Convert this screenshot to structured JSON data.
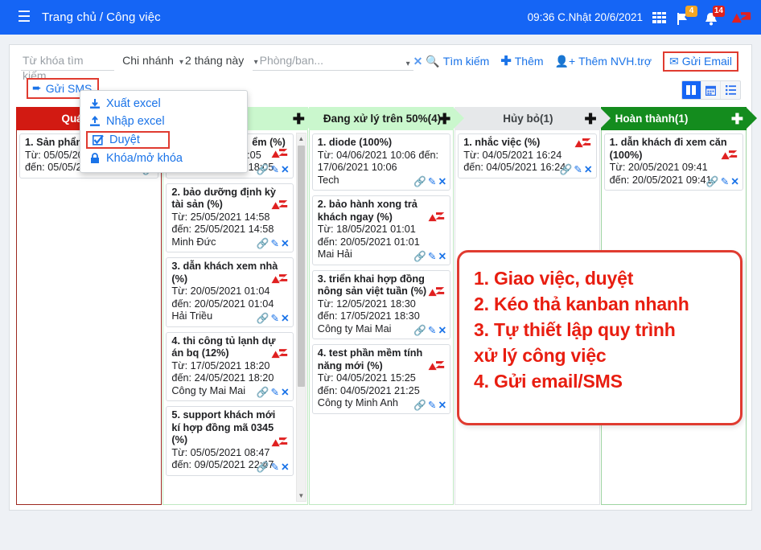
{
  "topbar": {
    "menu_icon": "hamburger-icon",
    "breadcrumb_home": "Trang chủ",
    "breadcrumb_sep": "/",
    "breadcrumb_current": "Công việc",
    "clock": "09:36  C.Nhật 20/6/2021",
    "apps_icon": "grid-apps-icon",
    "flag_badge": "4",
    "bell_badge": "14",
    "logo": "az-logo"
  },
  "filters": {
    "keyword_placeholder": "Từ khóa tìm kiếm...",
    "branch": "Chi nhánh",
    "period": "2 tháng này",
    "dept_placeholder": "Phòng/ban...",
    "search": "Tìm kiếm",
    "add": "Thêm",
    "add_support": "Thêm NVH.trợ",
    "send_email": "Gửi Email",
    "send_sms": "Gửi SMS"
  },
  "viewtoggle": {
    "kanban": "kanban-view-icon",
    "calendar": "calendar-view-icon",
    "list": "list-view-icon"
  },
  "menu": {
    "items": [
      {
        "label": "Xuất excel",
        "icon": "download-excel-icon",
        "highlighted": false
      },
      {
        "label": "Nhập excel",
        "icon": "upload-excel-icon",
        "highlighted": false
      },
      {
        "label": "Duyệt",
        "icon": "approve-check-icon",
        "highlighted": true
      },
      {
        "label": "Khóa/mở khóa",
        "icon": "lock-icon",
        "highlighted": false
      }
    ]
  },
  "board": {
    "columns": [
      {
        "title": "Quá hạn(1)",
        "cards": [
          {
            "title": "1. Sản phẩm l",
            "line1": "Từ: 05/05/202",
            "line2": "đến: 05/05/2021 00:09",
            "who": ""
          }
        ]
      },
      {
        "title": "",
        "cards": [
          {
            "title": "ểm (%)",
            "line1": "3:05",
            "line2": "đến: 31/05/2021 18:05",
            "who": ""
          },
          {
            "title": "2. bảo dưỡng định kỳ tài sản (%)",
            "line1": "Từ: 25/05/2021 14:58",
            "line2": "đến: 25/05/2021 14:58",
            "who": "Minh Đức"
          },
          {
            "title": "3. dẫn khách xem nhà (%)",
            "line1": "Từ: 20/05/2021 01:04",
            "line2": "đến: 20/05/2021 01:04",
            "who": "Hải Triều"
          },
          {
            "title": "4. thi công tủ lạnh dự án bq (12%)",
            "line1": "Từ: 17/05/2021 18:20",
            "line2": "đến: 24/05/2021 18:20",
            "who": "Công ty Mai Mai"
          },
          {
            "title": "5. support khách mới kí hợp đồng mã 0345 (%)",
            "line1": "Từ: 05/05/2021 08:47",
            "line2": "đến: 09/05/2021 22:47",
            "who": ""
          }
        ]
      },
      {
        "title": "Đang xử lý trên 50%(4)",
        "cards": [
          {
            "title": "1. diode (100%)",
            "line1": "Từ: 04/06/2021 10:06 đến:",
            "line2": "17/06/2021 10:06",
            "who": "Tech"
          },
          {
            "title": "2. bảo hành xong trả khách ngay (%)",
            "line1": "Từ: 18/05/2021 01:01",
            "line2": "đến: 20/05/2021 01:01",
            "who": "Mai Hải"
          },
          {
            "title": "3. triển khai hợp đồng nông sản việt tuần (%)",
            "line1": "Từ: 12/05/2021 18:30",
            "line2": "đến: 17/05/2021 18:30",
            "who": "Công ty Mai Mai"
          },
          {
            "title": "4. test phần mềm tính năng mới (%)",
            "line1": "Từ: 04/05/2021 15:25",
            "line2": "đến: 04/05/2021 21:25",
            "who": "Công ty Minh Anh"
          }
        ]
      },
      {
        "title": "Hủy bỏ(1)",
        "cards": [
          {
            "title": "1. nhắc việc (%)",
            "line1": "Từ: 04/05/2021 16:24",
            "line2": "đến: 04/05/2021 16:24",
            "who": ""
          }
        ]
      },
      {
        "title": "Hoàn thành(1)",
        "cards": [
          {
            "title": "1. dẫn khách đi xem căn (100%)",
            "line1": "Từ: 20/05/2021 09:41",
            "line2": "đến: 20/05/2021 09:41",
            "who": ""
          }
        ]
      }
    ],
    "card_icons": {
      "link": "link-icon",
      "edit": "edit-icon",
      "delete": "delete-x-icon"
    },
    "add_icon": "plus-icon"
  },
  "annotation": {
    "line1": "1. Giao việc, duyệt",
    "line2": "2. Kéo thả kanban nhanh",
    "line3": "3. Tự thiết lập quy trình",
    "line4": "xử lý công việc",
    "line5": "4. Gửi email/SMS"
  },
  "colors": {
    "topbar_blue": "#1565f5",
    "overdue_red": "#d21a12",
    "progress_green": "#caf7cd",
    "cancel_gray": "#e6e8ea",
    "done_green": "#148c1e",
    "link_blue": "#1a73e8",
    "annotation_red": "#e81d10"
  }
}
